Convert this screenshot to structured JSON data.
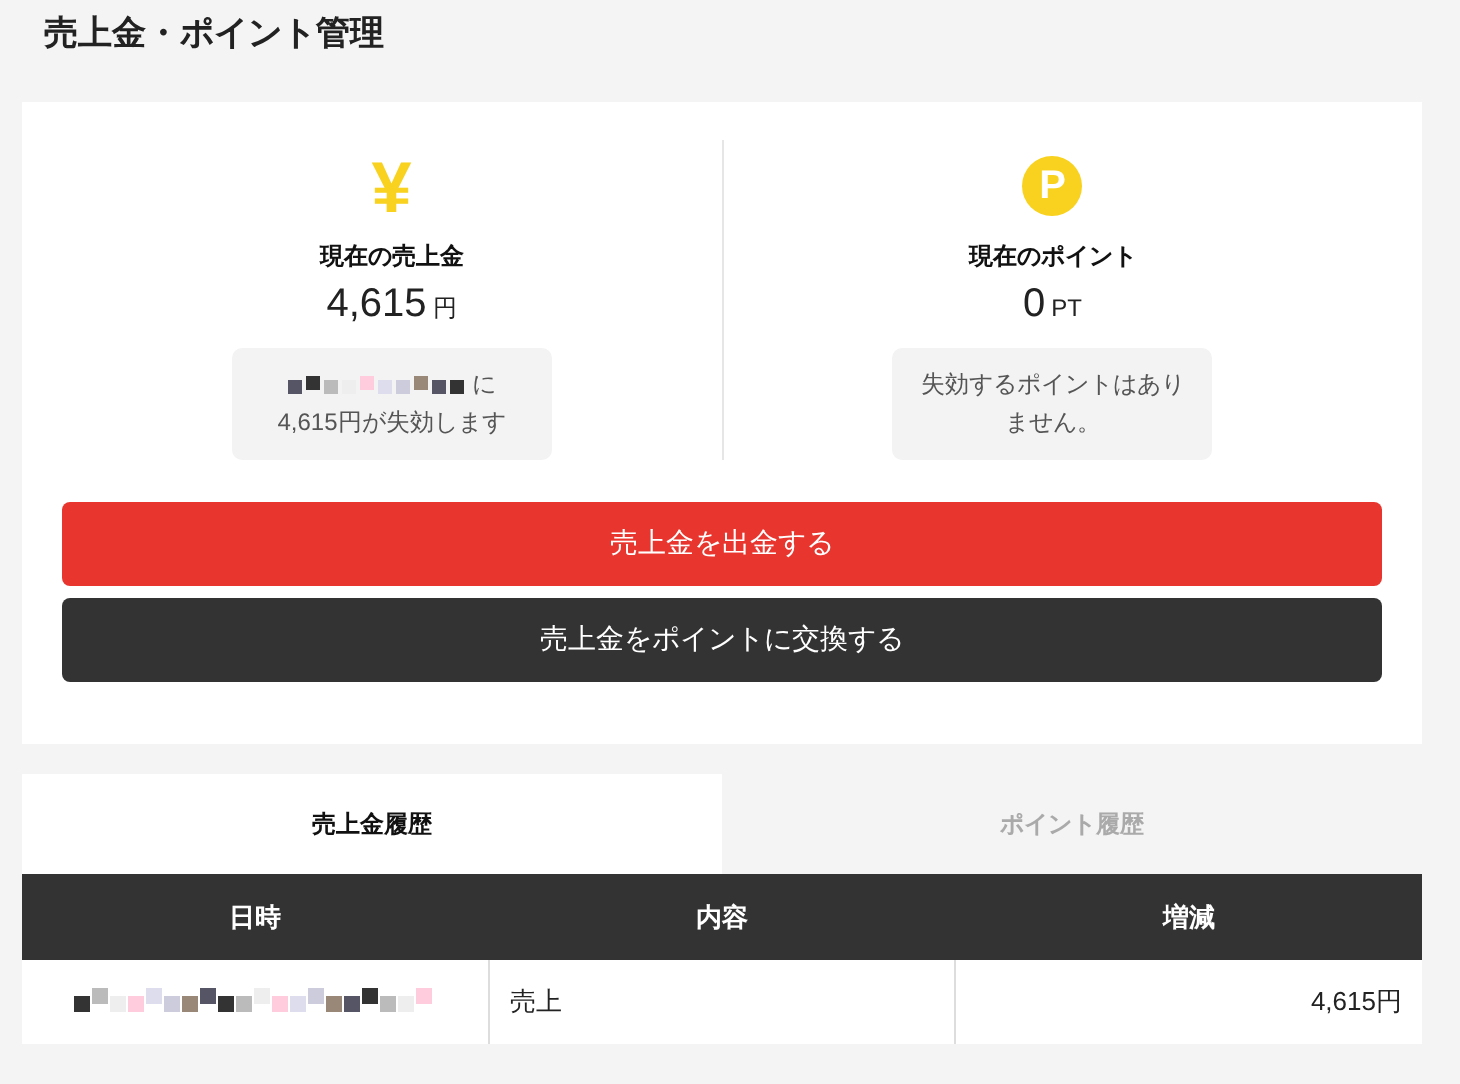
{
  "page_title": "売上金・ポイント管理",
  "balances": [
    {
      "kind": "yen",
      "icon": "¥",
      "label": "現在の売上金",
      "amount": "4,615",
      "unit": "円",
      "note_redacted": true,
      "note_lines": [
        "に",
        "4,615円が失効します"
      ]
    },
    {
      "kind": "point",
      "icon": "P",
      "label": "現在のポイント",
      "amount": "0",
      "unit": "PT",
      "note_redacted": false,
      "note_lines": [
        "失効するポイントはあり",
        "ません。"
      ]
    }
  ],
  "buttons": [
    {
      "kind": "primary",
      "label": "売上金を出金する"
    },
    {
      "kind": "secondary",
      "label": "売上金をポイントに交換する"
    }
  ],
  "tabs": [
    {
      "label": "売上金履歴",
      "selected": true
    },
    {
      "label": "ポイント履歴",
      "selected": false
    }
  ],
  "table": {
    "columns": [
      "日時",
      "内容",
      "増減"
    ],
    "rows": [
      {
        "date_redacted": true,
        "content": "売上",
        "change": "4,615円"
      }
    ]
  }
}
